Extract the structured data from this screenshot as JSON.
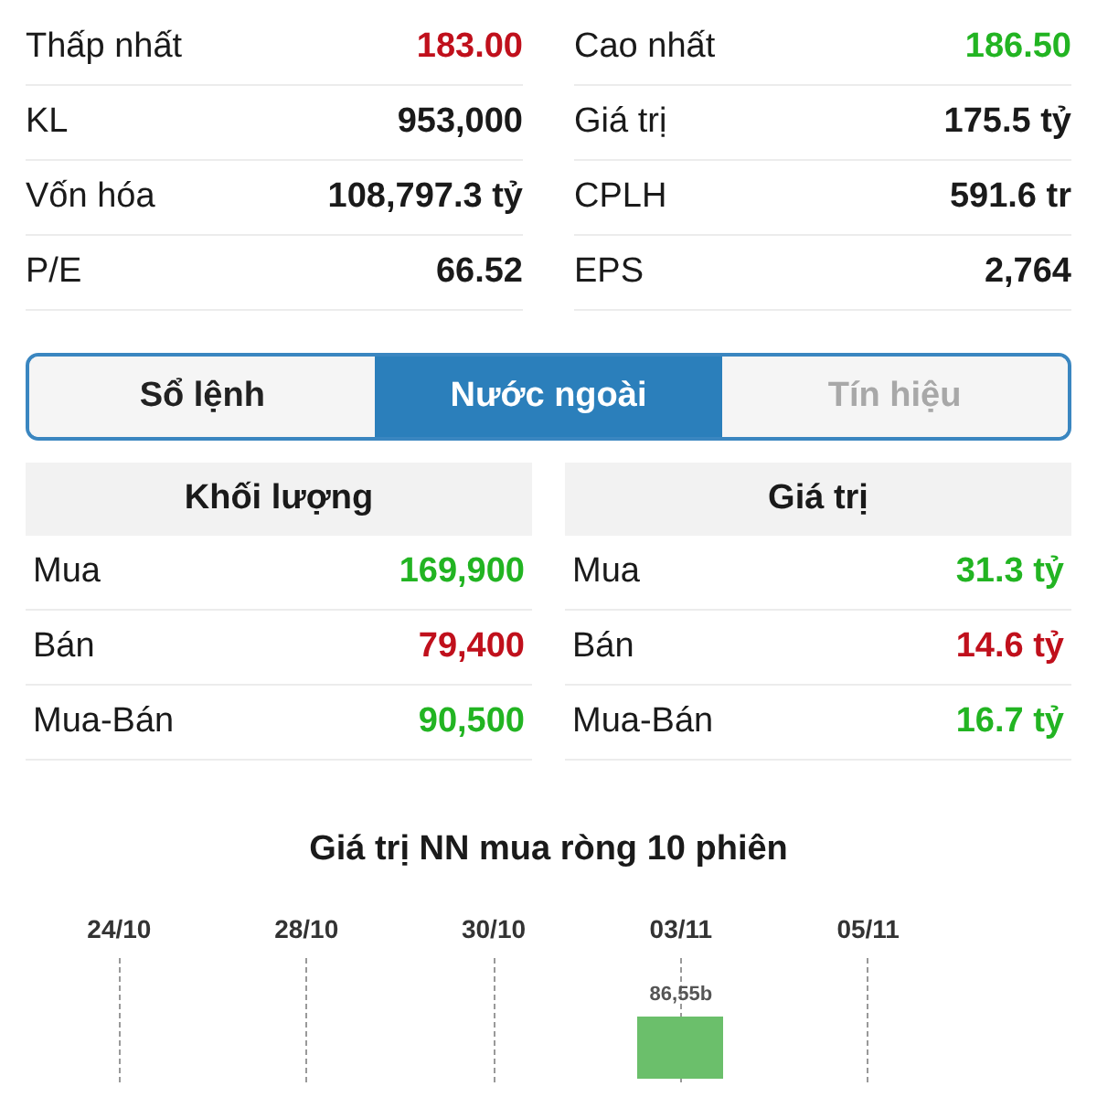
{
  "stats": [
    {
      "label": "Thấp nhất",
      "value": "183.00",
      "color": "#c0101c"
    },
    {
      "label": "Cao nhất",
      "value": "186.50",
      "color": "#22b422"
    },
    {
      "label": "KL",
      "value": "953,000",
      "color": "#1a1a1a"
    },
    {
      "label": "Giá trị",
      "value": "175.5 tỷ",
      "color": "#1a1a1a"
    },
    {
      "label": "Vốn hóa",
      "value": "108,797.3 tỷ",
      "color": "#1a1a1a"
    },
    {
      "label": "CPLH",
      "value": "591.6 tr",
      "color": "#1a1a1a"
    },
    {
      "label": "P/E",
      "value": "66.52",
      "color": "#1a1a1a"
    },
    {
      "label": "EPS",
      "value": "2,764",
      "color": "#1a1a1a"
    }
  ],
  "tabs": [
    {
      "label": "Sổ lệnh",
      "selected": false,
      "disabled": false
    },
    {
      "label": "Nước ngoài",
      "selected": true,
      "disabled": false
    },
    {
      "label": "Tín hiệu",
      "selected": false,
      "disabled": true
    }
  ],
  "panels": [
    {
      "header": "Khối lượng",
      "rows": [
        {
          "label": "Mua",
          "value": "169,900",
          "color": "#22b422"
        },
        {
          "label": "Bán",
          "value": "79,400",
          "color": "#c0101c"
        },
        {
          "label": "Mua-Bán",
          "value": "90,500",
          "color": "#22b422"
        }
      ]
    },
    {
      "header": "Giá trị",
      "rows": [
        {
          "label": "Mua",
          "value": "31.3 tỷ",
          "color": "#22b422"
        },
        {
          "label": "Bán",
          "value": "14.6 tỷ",
          "color": "#c0101c"
        },
        {
          "label": "Mua-Bán",
          "value": "16.7 tỷ",
          "color": "#22b422"
        }
      ]
    }
  ],
  "chart": {
    "title": "Giá trị NN mua ròng 10 phiên",
    "dates": [
      {
        "label": "24/10"
      },
      {
        "label": "28/10"
      },
      {
        "label": "30/10"
      },
      {
        "label": "03/11",
        "bar_label": "86,55b"
      },
      {
        "label": "05/11"
      }
    ]
  }
}
